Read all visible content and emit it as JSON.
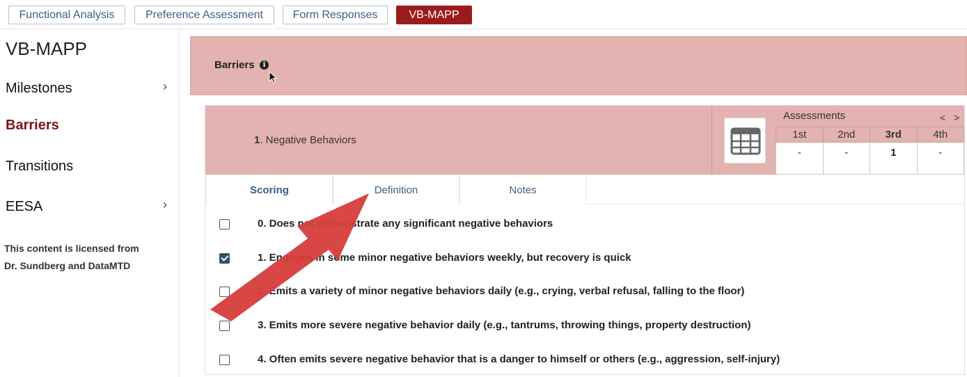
{
  "top_tabs": [
    {
      "label": "Functional Analysis"
    },
    {
      "label": "Preference Assessment"
    },
    {
      "label": "Form Responses"
    },
    {
      "label": "VB-MAPP"
    }
  ],
  "sidebar": {
    "title": "VB-MAPP",
    "items": [
      {
        "label": "Milestones",
        "chevron": ">"
      },
      {
        "label": "Barriers"
      },
      {
        "label": "Transitions"
      },
      {
        "label": "EESA",
        "chevron": ">"
      }
    ],
    "license_line1": "This content is licensed from",
    "license_line2": "Dr. Sundberg and DataMTD"
  },
  "header": {
    "title": "Barriers",
    "info_icon": "i"
  },
  "item": {
    "number": "1",
    "title": ". Negative Behaviors"
  },
  "assessments": {
    "label": "Assessments",
    "prev": "<",
    "next": ">",
    "columns": [
      "1st",
      "2nd",
      "3rd",
      "4th"
    ],
    "values": [
      "-",
      "-",
      "1",
      "-"
    ],
    "current_index": 2
  },
  "subtabs": [
    {
      "label": "Scoring"
    },
    {
      "label": "Definition"
    },
    {
      "label": "Notes"
    }
  ],
  "options": [
    {
      "text": "0. Does not demonstrate any significant negative behaviors",
      "checked": false
    },
    {
      "text": "1. Engages in some minor negative behaviors weekly, but recovery is quick",
      "checked": true
    },
    {
      "text": "2. Emits a variety of minor negative behaviors daily (e.g., crying, verbal refusal, falling to the floor)",
      "checked": false
    },
    {
      "text": "3. Emits more severe negative behavior daily (e.g., tantrums, throwing things, property destruction)",
      "checked": false
    },
    {
      "text": "4. Often emits severe negative behavior that is a danger to himself or others (e.g., aggression, self-injury)",
      "checked": false
    }
  ],
  "colors": {
    "accent": "#9b1c1c",
    "band": "#e2b3b0",
    "link": "#3b5f86",
    "arrow": "#d63c3c"
  }
}
